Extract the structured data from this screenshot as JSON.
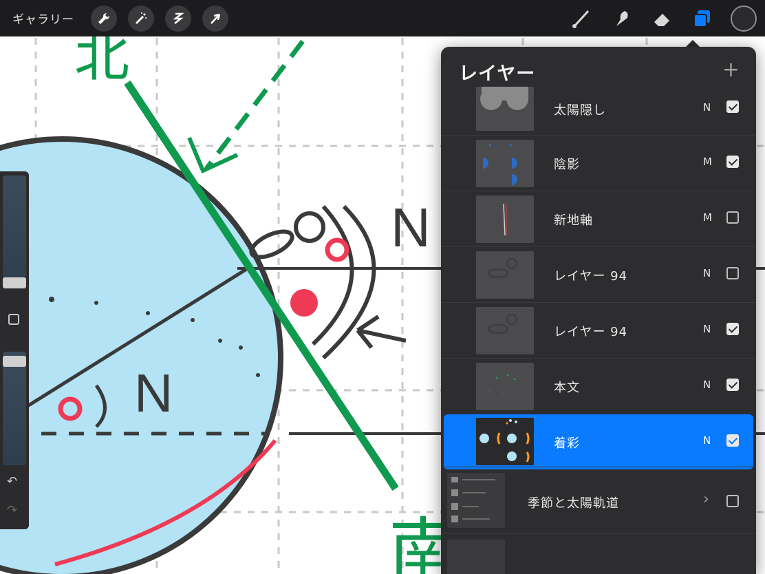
{
  "topbar": {
    "gallery_label": "ギャラリー",
    "left_tools": [
      "wrench-icon",
      "magic-wand-icon",
      "selection-icon",
      "transform-arrow-icon"
    ],
    "right_tools": [
      "brush-icon",
      "smudge-icon",
      "eraser-icon",
      "layers-icon"
    ],
    "active_tool": "layers-icon",
    "active_color": "#0a7aff"
  },
  "sidebar": {
    "brush_size_level": 0.3,
    "opacity_level": 0.8,
    "modify_button": "square-icon",
    "undo": "undo-icon",
    "redo": "redo-icon"
  },
  "layers": {
    "title": "レイヤー",
    "add_label": "+",
    "items": [
      {
        "name": "太陽隠し",
        "blend": "N",
        "visible": true,
        "selected": false
      },
      {
        "name": "陰影",
        "blend": "M",
        "visible": true,
        "selected": false
      },
      {
        "name": "新地軸",
        "blend": "M",
        "visible": false,
        "selected": false
      },
      {
        "name": "レイヤー 94",
        "blend": "N",
        "visible": false,
        "selected": false
      },
      {
        "name": "レイヤー 94",
        "blend": "N",
        "visible": true,
        "selected": false
      },
      {
        "name": "本文",
        "blend": "N",
        "visible": true,
        "selected": false
      },
      {
        "name": "着彩",
        "blend": "N",
        "visible": true,
        "selected": true
      }
    ],
    "group": {
      "name": "季節と太陽軌道",
      "visible": false
    }
  },
  "canvas": {
    "labels": [
      "N",
      "N",
      "北",
      "南"
    ],
    "colors": {
      "sky": "#b3e3f5",
      "green": "#0f9a4f",
      "red": "#ee3a55",
      "ink": "#3a3a3a"
    }
  }
}
